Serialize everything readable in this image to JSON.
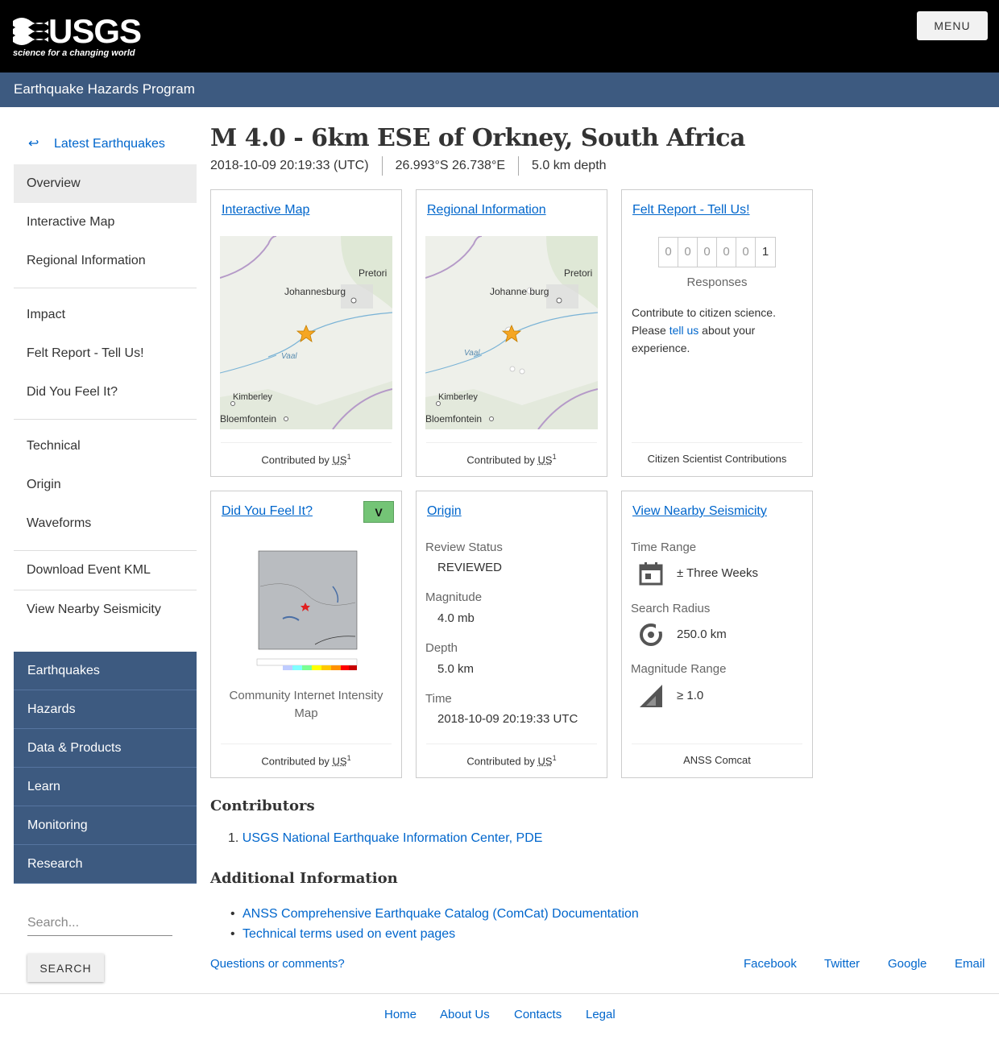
{
  "header": {
    "logo_word": "USGS",
    "logo_tagline": "science for a changing world",
    "menu_label": "MENU",
    "program_title": "Earthquake Hazards Program"
  },
  "sidebar": {
    "back_arrow": "↩",
    "back_label": "Latest Earthquakes",
    "items": [
      "Overview",
      "Interactive Map",
      "Regional Information",
      "Impact",
      "Felt Report - Tell Us!",
      "Did You Feel It?",
      "Technical",
      "Origin",
      "Waveforms",
      "Download Event KML",
      "View Nearby Seismicity"
    ],
    "nav": [
      "Earthquakes",
      "Hazards",
      "Data & Products",
      "Learn",
      "Monitoring",
      "Research"
    ],
    "search_placeholder": "Search...",
    "search_button": "SEARCH"
  },
  "event": {
    "title": "M 4.0 - 6km ESE of Orkney, South Africa",
    "time": "2018-10-09 20:19:33 (UTC)",
    "location": "26.993°S 26.738°E",
    "depth": "5.0 km depth"
  },
  "cards": {
    "interactive_map": {
      "title": "Interactive Map",
      "labels": {
        "pretoria": "Pretori",
        "johannesburg": "Johannesburg",
        "vaal": "Vaal",
        "kimberley": "Kimberley",
        "bloemfontein": "Bloemfontein"
      },
      "footer_prefix": "Contributed by ",
      "footer_net": "US",
      "footer_sup": "1"
    },
    "regional": {
      "title": "Regional Information",
      "labels": {
        "pretoria": "Pretori",
        "johannesburg": "Johanne burg",
        "vaal": "Vaal",
        "kimberley": "Kimberley",
        "bloemfontein": "Bloemfontein"
      },
      "footer_prefix": "Contributed by ",
      "footer_net": "US",
      "footer_sup": "1"
    },
    "felt": {
      "title": "Felt Report - Tell Us!",
      "digits": [
        "0",
        "0",
        "0",
        "0",
        "0",
        "1"
      ],
      "responses": "Responses",
      "text_before": "Contribute to citizen science. Please ",
      "link": "tell us",
      "text_after": " about your experience.",
      "footer": "Citizen Scientist Contributions"
    },
    "dyfi": {
      "title": "Did You Feel It?",
      "cdi": "V",
      "caption": "Community Internet Intensity Map",
      "footer_prefix": "Contributed by ",
      "footer_net": "US",
      "footer_sup": "1"
    },
    "origin": {
      "title": "Origin",
      "review_label": "Review Status",
      "review_value": "REVIEWED",
      "mag_label": "Magnitude",
      "mag_value": "4.0 mb",
      "depth_label": "Depth",
      "depth_value": "5.0 km",
      "time_label": "Time",
      "time_value": "2018-10-09 20:19:33 UTC",
      "footer_prefix": "Contributed by ",
      "footer_net": "US",
      "footer_sup": "1"
    },
    "seismicity": {
      "title": "View Nearby Seismicity",
      "time_label": "Time Range",
      "time_value": "± Three Weeks",
      "radius_label": "Search Radius",
      "radius_value": "250.0 km",
      "mag_label": "Magnitude Range",
      "mag_value": "≥ 1.0",
      "footer": "ANSS Comcat"
    }
  },
  "contributors": {
    "heading": "Contributors",
    "items": [
      "USGS National Earthquake Information Center, PDE"
    ]
  },
  "additional": {
    "heading": "Additional Information",
    "items": [
      "ANSS Comprehensive Earthquake Catalog (ComCat) Documentation",
      "Technical terms used on event pages"
    ]
  },
  "footer": {
    "questions": "Questions or comments?",
    "social": [
      "Facebook",
      "Twitter",
      "Google",
      "Email"
    ],
    "bottom": [
      "Home",
      "About Us",
      "Contacts",
      "Legal"
    ]
  }
}
